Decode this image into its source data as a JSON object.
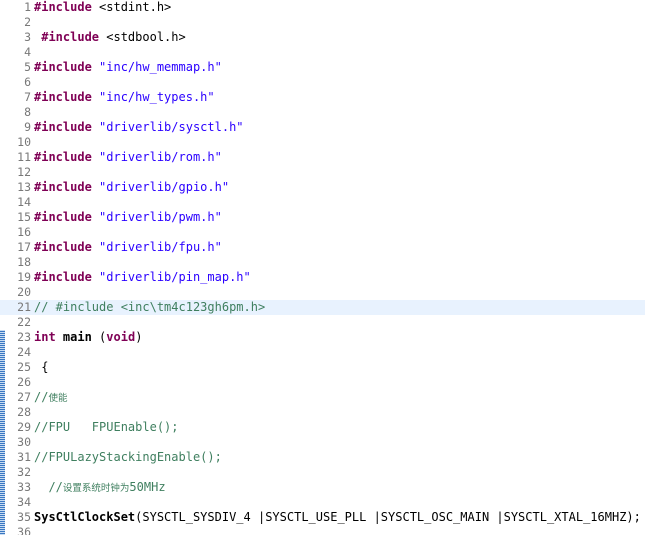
{
  "editor": {
    "language": "C",
    "colors": {
      "keyword": "#7f0055",
      "string": "#2a00ff",
      "comment": "#3f7f5f",
      "line_number": "#787878",
      "current_line": "#e8f2fe",
      "change_marker": "#3a78c2"
    },
    "highlighted_line": 21,
    "changed_line_ranges": [
      [
        23,
        36
      ]
    ],
    "lines": [
      {
        "n": "1",
        "tokens": [
          {
            "t": "#include",
            "c": "kw"
          },
          {
            "t": " <stdint.h>",
            "c": "plain"
          }
        ]
      },
      {
        "n": "2",
        "tokens": []
      },
      {
        "n": "3",
        "tokens": [
          {
            "t": " ",
            "c": "plain"
          },
          {
            "t": "#include",
            "c": "kw"
          },
          {
            "t": " <stdbool.h>",
            "c": "plain"
          }
        ]
      },
      {
        "n": "4",
        "tokens": []
      },
      {
        "n": "5",
        "tokens": [
          {
            "t": "#include",
            "c": "kw"
          },
          {
            "t": " ",
            "c": "plain"
          },
          {
            "t": "\"inc/hw_memmap.h\"",
            "c": "str"
          }
        ]
      },
      {
        "n": "6",
        "tokens": []
      },
      {
        "n": "7",
        "tokens": [
          {
            "t": "#include",
            "c": "kw"
          },
          {
            "t": " ",
            "c": "plain"
          },
          {
            "t": "\"inc/hw_types.h\"",
            "c": "str"
          }
        ]
      },
      {
        "n": "8",
        "tokens": []
      },
      {
        "n": "9",
        "tokens": [
          {
            "t": "#include",
            "c": "kw"
          },
          {
            "t": " ",
            "c": "plain"
          },
          {
            "t": "\"driverlib/sysctl.h\"",
            "c": "str"
          }
        ]
      },
      {
        "n": "10",
        "tokens": []
      },
      {
        "n": "11",
        "tokens": [
          {
            "t": "#include",
            "c": "kw"
          },
          {
            "t": " ",
            "c": "plain"
          },
          {
            "t": "\"driverlib/rom.h\"",
            "c": "str"
          }
        ]
      },
      {
        "n": "12",
        "tokens": []
      },
      {
        "n": "13",
        "tokens": [
          {
            "t": "#include",
            "c": "kw"
          },
          {
            "t": " ",
            "c": "plain"
          },
          {
            "t": "\"driverlib/gpio.h\"",
            "c": "str"
          }
        ]
      },
      {
        "n": "14",
        "tokens": []
      },
      {
        "n": "15",
        "tokens": [
          {
            "t": "#include",
            "c": "kw"
          },
          {
            "t": " ",
            "c": "plain"
          },
          {
            "t": "\"driverlib/pwm.h\"",
            "c": "str"
          }
        ]
      },
      {
        "n": "16",
        "tokens": []
      },
      {
        "n": "17",
        "tokens": [
          {
            "t": "#include",
            "c": "kw"
          },
          {
            "t": " ",
            "c": "plain"
          },
          {
            "t": "\"driverlib/fpu.h\"",
            "c": "str"
          }
        ]
      },
      {
        "n": "18",
        "tokens": []
      },
      {
        "n": "19",
        "tokens": [
          {
            "t": "#include",
            "c": "kw"
          },
          {
            "t": " ",
            "c": "plain"
          },
          {
            "t": "\"driverlib/pin_map.h\"",
            "c": "str"
          }
        ]
      },
      {
        "n": "20",
        "tokens": []
      },
      {
        "n": "21",
        "tokens": [
          {
            "t": "// #include <inc\\tm4c123gh6pm.h>",
            "c": "cm"
          }
        ]
      },
      {
        "n": "22",
        "tokens": []
      },
      {
        "n": "23",
        "tokens": [
          {
            "t": "int",
            "c": "kw"
          },
          {
            "t": " ",
            "c": "plain"
          },
          {
            "t": "main",
            "c": "fn"
          },
          {
            "t": " (",
            "c": "plain"
          },
          {
            "t": "void",
            "c": "kw"
          },
          {
            "t": ")",
            "c": "plain"
          }
        ]
      },
      {
        "n": "24",
        "tokens": []
      },
      {
        "n": "25",
        "tokens": [
          {
            "t": " {",
            "c": "plain"
          }
        ]
      },
      {
        "n": "26",
        "tokens": []
      },
      {
        "n": "27",
        "tokens": [
          {
            "t": "//",
            "c": "cm"
          },
          {
            "t": "使能",
            "c": "cm-small"
          }
        ]
      },
      {
        "n": "28",
        "tokens": []
      },
      {
        "n": "29",
        "tokens": [
          {
            "t": "//FPU   FPUEnable();",
            "c": "cm"
          }
        ]
      },
      {
        "n": "30",
        "tokens": []
      },
      {
        "n": "31",
        "tokens": [
          {
            "t": "//FPULazyStackingEnable();",
            "c": "cm"
          }
        ]
      },
      {
        "n": "32",
        "tokens": []
      },
      {
        "n": "33",
        "tokens": [
          {
            "t": "  //",
            "c": "cm"
          },
          {
            "t": "设置系统时钟为",
            "c": "cm-small"
          },
          {
            "t": "50MHz",
            "c": "cm"
          }
        ]
      },
      {
        "n": "34",
        "tokens": []
      },
      {
        "n": "35",
        "tokens": [
          {
            "t": "SysCtlClockSet",
            "c": "fn"
          },
          {
            "t": "(SYSCTL_SYSDIV_4 |SYSCTL_USE_PLL |SYSCTL_OSC_MAIN |SYSCTL_XTAL_16MHZ);",
            "c": "plain"
          }
        ]
      },
      {
        "n": "36",
        "tokens": []
      }
    ]
  }
}
